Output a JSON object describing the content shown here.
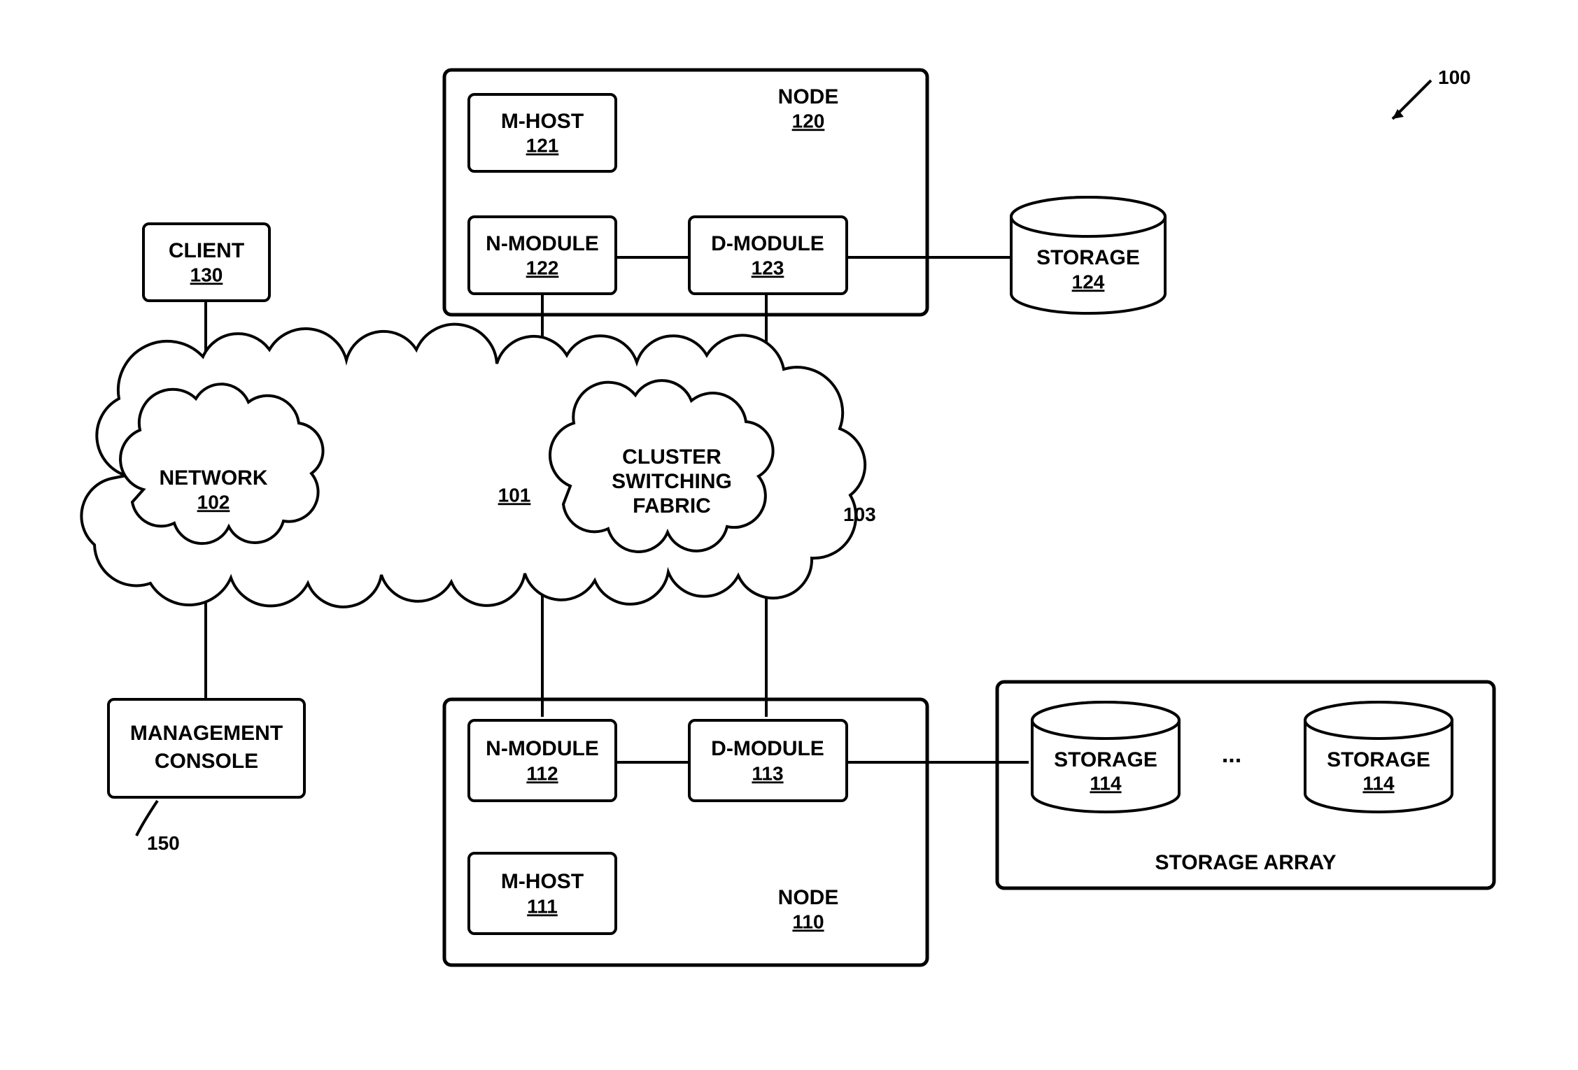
{
  "figure_ref": "100",
  "network_region_ref": "101",
  "csf_ref": "103",
  "client": {
    "label": "CLIENT",
    "ref": "130"
  },
  "management_console": {
    "label1": "MANAGEMENT",
    "label2": "CONSOLE",
    "ref": "150"
  },
  "network_cloud": {
    "label": "NETWORK",
    "ref": "102"
  },
  "csf": {
    "line1": "CLUSTER",
    "line2": "SWITCHING",
    "line3": "FABRIC"
  },
  "node_top": {
    "label": "NODE",
    "ref": "120",
    "mhost": {
      "label": "M-HOST",
      "ref": "121"
    },
    "nmod": {
      "label": "N-MODULE",
      "ref": "122"
    },
    "dmod": {
      "label": "D-MODULE",
      "ref": "123"
    }
  },
  "storage_top": {
    "label": "STORAGE",
    "ref": "124"
  },
  "node_bottom": {
    "label": "NODE",
    "ref": "110",
    "mhost": {
      "label": "M-HOST",
      "ref": "111"
    },
    "nmod": {
      "label": "N-MODULE",
      "ref": "112"
    },
    "dmod": {
      "label": "D-MODULE",
      "ref": "113"
    }
  },
  "storage_array": {
    "label": "STORAGE ARRAY",
    "item": {
      "label": "STORAGE",
      "ref": "114"
    },
    "ellipsis": "..."
  }
}
